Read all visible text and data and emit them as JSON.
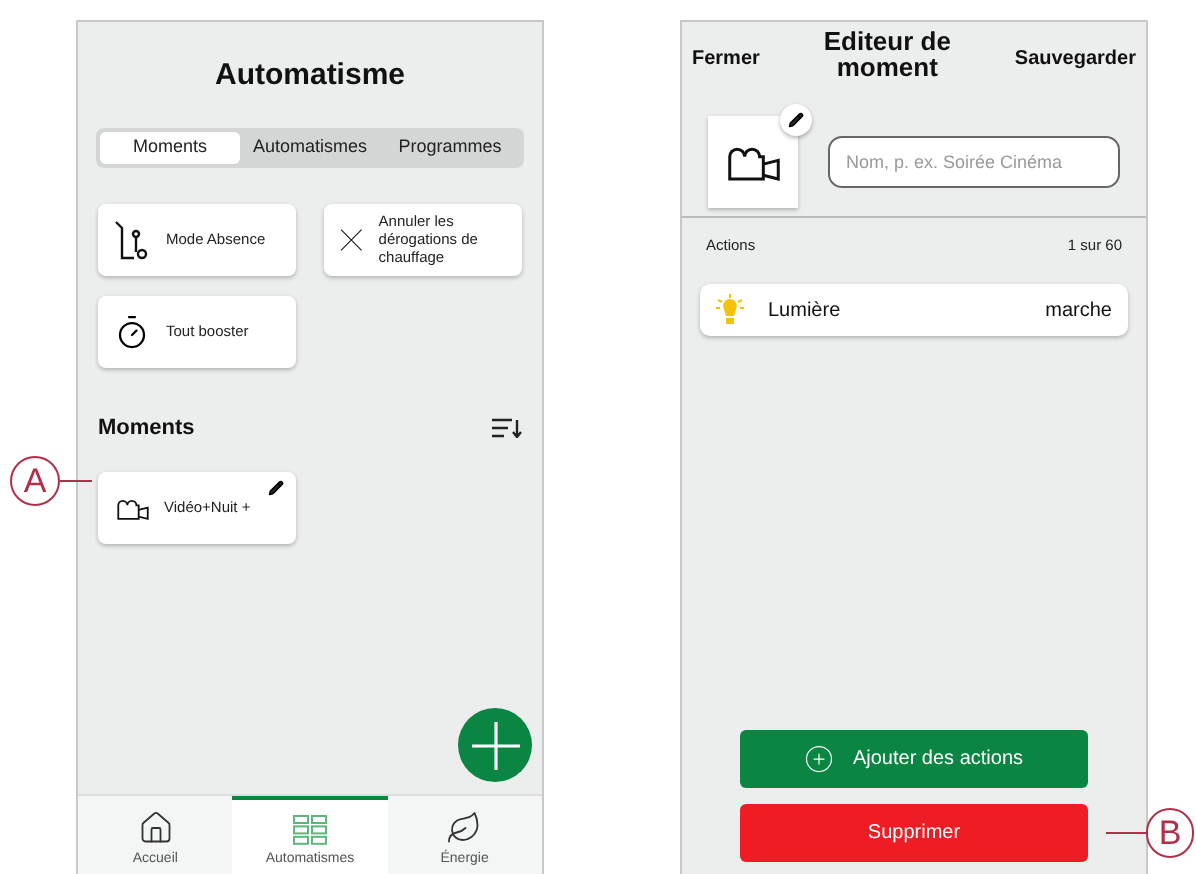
{
  "automatisme_screen": {
    "title": "Automatisme",
    "tabs": [
      {
        "label": "Moments",
        "selected": true
      },
      {
        "label": "Automatismes",
        "selected": false
      },
      {
        "label": "Programmes",
        "selected": false
      }
    ],
    "quick_actions": [
      {
        "kind": "away",
        "label": "Mode Absence"
      },
      {
        "kind": "cancel",
        "label": "Annuler les dérogations de chauffage"
      },
      {
        "kind": "boost",
        "label": "Tout booster"
      }
    ],
    "moments_heading": "Moments",
    "moments": [
      {
        "label": "Vidéo+Nuit +"
      }
    ],
    "nav": [
      {
        "kind": "home",
        "label": "Accueil",
        "selected": false
      },
      {
        "kind": "grid",
        "label": "Automatismes",
        "selected": true
      },
      {
        "kind": "leaf",
        "label": "Énergie",
        "selected": false
      }
    ]
  },
  "editor_screen": {
    "close": "Fermer",
    "title": "Editeur de moment",
    "save": "Sauvegarder",
    "name_field": {
      "placeholder": "Nom, p. ex. Soirée Cinéma"
    },
    "actions_label": "Actions",
    "actions_count": "1 sur 60",
    "actions": [
      {
        "name": "Lumière",
        "state": "marche"
      }
    ],
    "add_button": "Ajouter des actions",
    "delete_button": "Supprimer"
  },
  "callouts": [
    {
      "label": "A"
    },
    {
      "label": "B"
    }
  ]
}
